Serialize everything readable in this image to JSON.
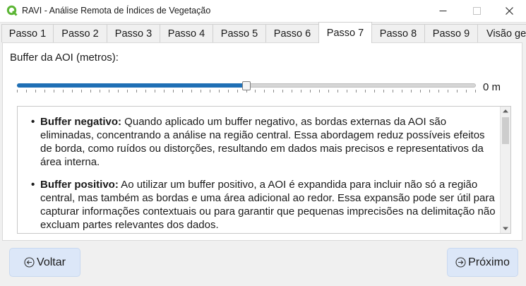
{
  "window": {
    "title": "RAVI - Análise Remota de Índices de Vegetação",
    "icon": "qgis-logo-icon",
    "colors": {
      "accent": "#1f6fb5",
      "button_bg": "#dce7f8",
      "logo": "#5bb534"
    }
  },
  "tabs": [
    {
      "label": "Passo 1"
    },
    {
      "label": "Passo 2"
    },
    {
      "label": "Passo 3"
    },
    {
      "label": "Passo 4"
    },
    {
      "label": "Passo 5"
    },
    {
      "label": "Passo 6"
    },
    {
      "label": "Passo 7",
      "active": true
    },
    {
      "label": "Passo 8"
    },
    {
      "label": "Passo 9"
    },
    {
      "label": "Visão ge"
    }
  ],
  "buffer": {
    "label": "Buffer da AOI (metros):",
    "value_text": "0 m",
    "slider_fraction": 0.5
  },
  "info": {
    "items": [
      {
        "bold": "Buffer negativo:",
        "text": " Quando aplicado um buffer negativo, as bordas externas da AOI são eliminadas, concentrando a análise na região central. Essa abordagem reduz possíveis efeitos de borda, como ruídos ou distorções, resultando em dados mais precisos e representativos da área interna."
      },
      {
        "bold": "Buffer positivo:",
        "text": " Ao utilizar um buffer positivo, a AOI é expandida para incluir não só a região central, mas também as bordas e uma área adicional ao redor. Essa expansão pode ser útil para capturar informações contextuais ou para garantir que pequenas imprecisões na delimitação não excluam partes relevantes dos dados."
      }
    ]
  },
  "nav": {
    "back_label": "Voltar",
    "next_label": "Próximo",
    "back_icon": "circle-arrow-left-icon",
    "next_icon": "circle-arrow-right-icon"
  }
}
